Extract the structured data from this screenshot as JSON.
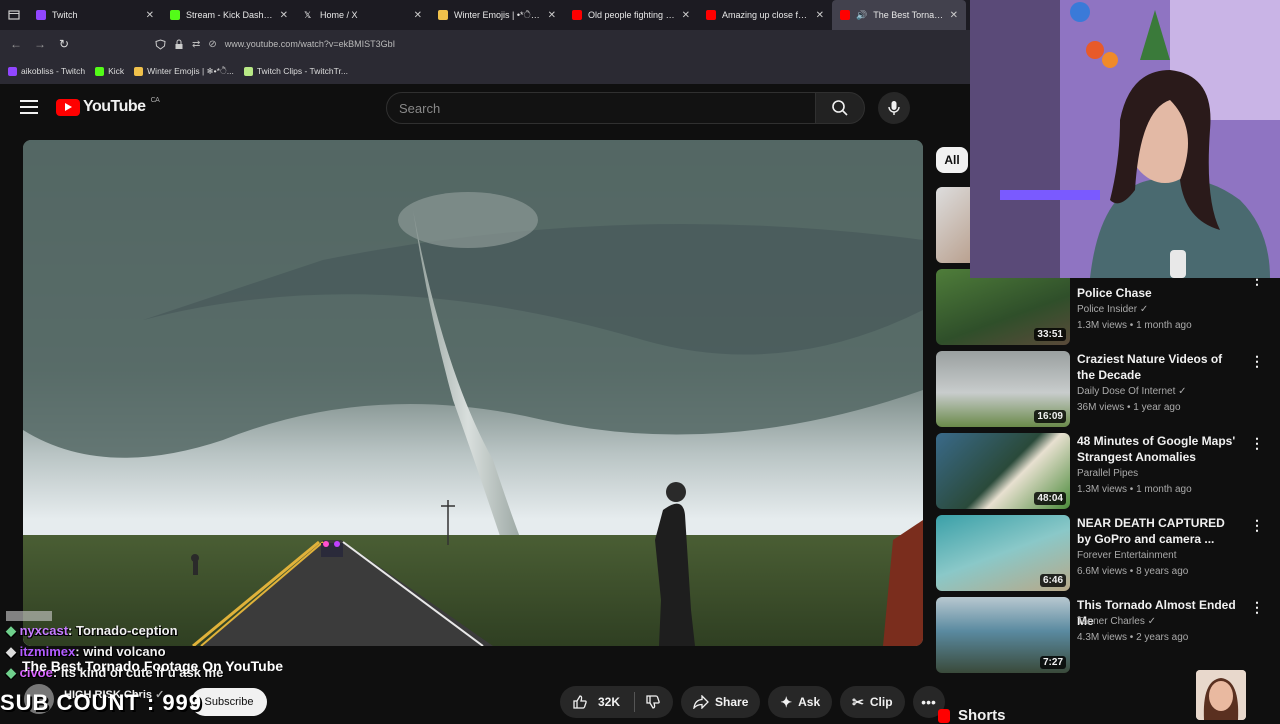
{
  "browser": {
    "tabs": [
      {
        "label": "Twitch",
        "color": "#9146ff"
      },
      {
        "label": "Stream - Kick Dashboard",
        "color": "#53fc18"
      },
      {
        "label": "Home / X",
        "color": "#ffffff"
      },
      {
        "label": "Winter Emojis | •*ੈ✩‧₊˚",
        "color": "#f0c14b"
      },
      {
        "label": "Old people fighting - YouTu",
        "color": "#ff0000"
      },
      {
        "label": "Amazing up close footage",
        "color": "#ff0000"
      },
      {
        "label": "The Best Tornado Foot",
        "color": "#ff0000"
      }
    ],
    "url": "www.youtube.com/watch?v=ekBMIST3GbI",
    "bookmarks": [
      {
        "label": "aikobliss - Twitch",
        "color": "#9146ff"
      },
      {
        "label": "Kick",
        "color": "#53fc18"
      },
      {
        "label": "Winter Emojis | ❄︎•*ੈ...",
        "color": "#f0c14b"
      },
      {
        "label": "Twitch Clips - TwitchTr...",
        "color": "#b8e986"
      }
    ]
  },
  "youtube": {
    "logo_text": "YouTube",
    "region": "CA",
    "search_placeholder": "Search"
  },
  "video": {
    "title": "The Best Tornado Footage On YouTube",
    "channel": "HIGH RISK Chris",
    "subscribe_label": "Subscribe",
    "likes": "32K",
    "share_label": "Share",
    "ask_label": "Ask",
    "clip_label": "Clip"
  },
  "chat": [
    {
      "user": "nyxcast",
      "message": "Tornado-ception"
    },
    {
      "user": "itzmimex",
      "message": "wind volcano"
    },
    {
      "user": "civoe",
      "message": "its kind of cute if u ask me"
    }
  ],
  "overlay": {
    "sub_count": "SUB COUNT : 999"
  },
  "sidebar": {
    "chip_all": "All",
    "recommendations": [
      {
        "title": "Police Chase",
        "channel": "Police Insider",
        "meta": "1.3M views • 1 month ago",
        "duration": "33:51",
        "verified": true
      },
      {
        "title": "Craziest Nature Videos of the Decade",
        "channel": "Daily Dose Of Internet",
        "meta": "36M views • 1 year ago",
        "duration": "16:09",
        "verified": true
      },
      {
        "title": "48 Minutes of Google Maps' Strangest Anomalies",
        "channel": "Parallel Pipes",
        "meta": "1.3M views • 1 month ago",
        "duration": "48:04",
        "verified": false
      },
      {
        "title": "NEAR DEATH CAPTURED by GoPro and camera ...",
        "channel": "Forever Entertainment",
        "meta": "6.6M views • 8 years ago",
        "duration": "6:46",
        "verified": false
      },
      {
        "title": "This Tornado Almost Ended Me",
        "channel": "Tanner Charles",
        "meta": "4.3M views • 2 years ago",
        "duration": "7:27",
        "verified": true
      }
    ],
    "shorts_label": "Shorts"
  }
}
